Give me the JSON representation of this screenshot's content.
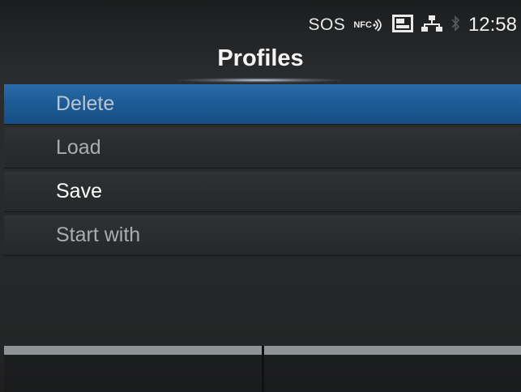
{
  "status": {
    "sos": "SOS",
    "nfc": "NFC",
    "clock": "12:58",
    "icons": [
      "nfc-icon",
      "sd-card-icon",
      "network-icon",
      "bluetooth-icon"
    ]
  },
  "title": "Profiles",
  "menu": {
    "items": [
      {
        "label": "Delete",
        "state": "selected"
      },
      {
        "label": "Load",
        "state": "normal"
      },
      {
        "label": "Save",
        "state": "active"
      },
      {
        "label": "Start with",
        "state": "normal"
      }
    ]
  },
  "softkeys": {
    "left": "",
    "right": ""
  },
  "colors": {
    "selection": "#1c5a95",
    "background": "#242526"
  }
}
